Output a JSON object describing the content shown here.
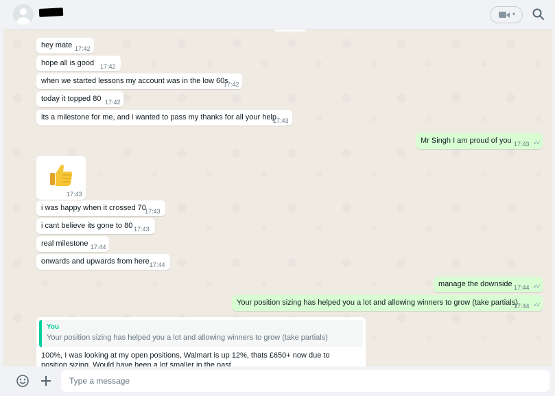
{
  "header": {
    "contact_name": "",
    "icons": {
      "avatar": "default-avatar",
      "video": "video-camera-icon",
      "dropdown": "chevron-down-icon",
      "search": "search-icon"
    }
  },
  "colors": {
    "chat_background": "#efeae2",
    "incoming_bubble": "#ffffff",
    "outgoing_bubble": "#d9fdd3",
    "quote_accent": "#06cf9c",
    "timestamp": "#667781"
  },
  "messages": [
    {
      "direction": "in",
      "text": "hey mate",
      "time": "17:42"
    },
    {
      "direction": "in",
      "text": "hope all is good",
      "time": "17:42"
    },
    {
      "direction": "in",
      "text": "when we started lessons my account was in the low 60s",
      "time": "17:42"
    },
    {
      "direction": "in",
      "text": "today it topped 80",
      "time": "17:42"
    },
    {
      "direction": "in",
      "text": "its a milestone for me, and i wanted to pass my thanks for all your help",
      "time": "17:43"
    },
    {
      "direction": "out",
      "text": "Mr Singh I am proud of you",
      "time": "17:43",
      "status": "read"
    },
    {
      "direction": "in",
      "type": "sticker",
      "emoji": "thumbs-up",
      "time": "17:43"
    },
    {
      "direction": "in",
      "text": "i was happy when it crossed 70",
      "time": "17:43"
    },
    {
      "direction": "in",
      "text": "i cant believe its gone to 80",
      "time": "17:43"
    },
    {
      "direction": "in",
      "text": "real milestone",
      "time": "17:44"
    },
    {
      "direction": "in",
      "text": "onwards and upwards from here",
      "time": "17:44"
    },
    {
      "direction": "out",
      "text": "manage the downside",
      "time": "17:44",
      "status": "read"
    },
    {
      "direction": "out",
      "text": "Your position sizing has helped you a lot and allowing winners to grow (take partials)",
      "time": "17:44",
      "status": "read"
    }
  ],
  "reply": {
    "quoted_author": "You",
    "quoted_text": "Your position sizing has helped you a lot and allowing winners to grow (take partials)",
    "text": "100%, I was looking at my open positions, Walmart is up 12%, thats £650+ now due to position sizing. Would have been a lot smaller in the past"
  },
  "footer": {
    "placeholder": "Type a message",
    "icons": {
      "emoji": "emoji-icon",
      "attach": "plus-icon"
    }
  }
}
